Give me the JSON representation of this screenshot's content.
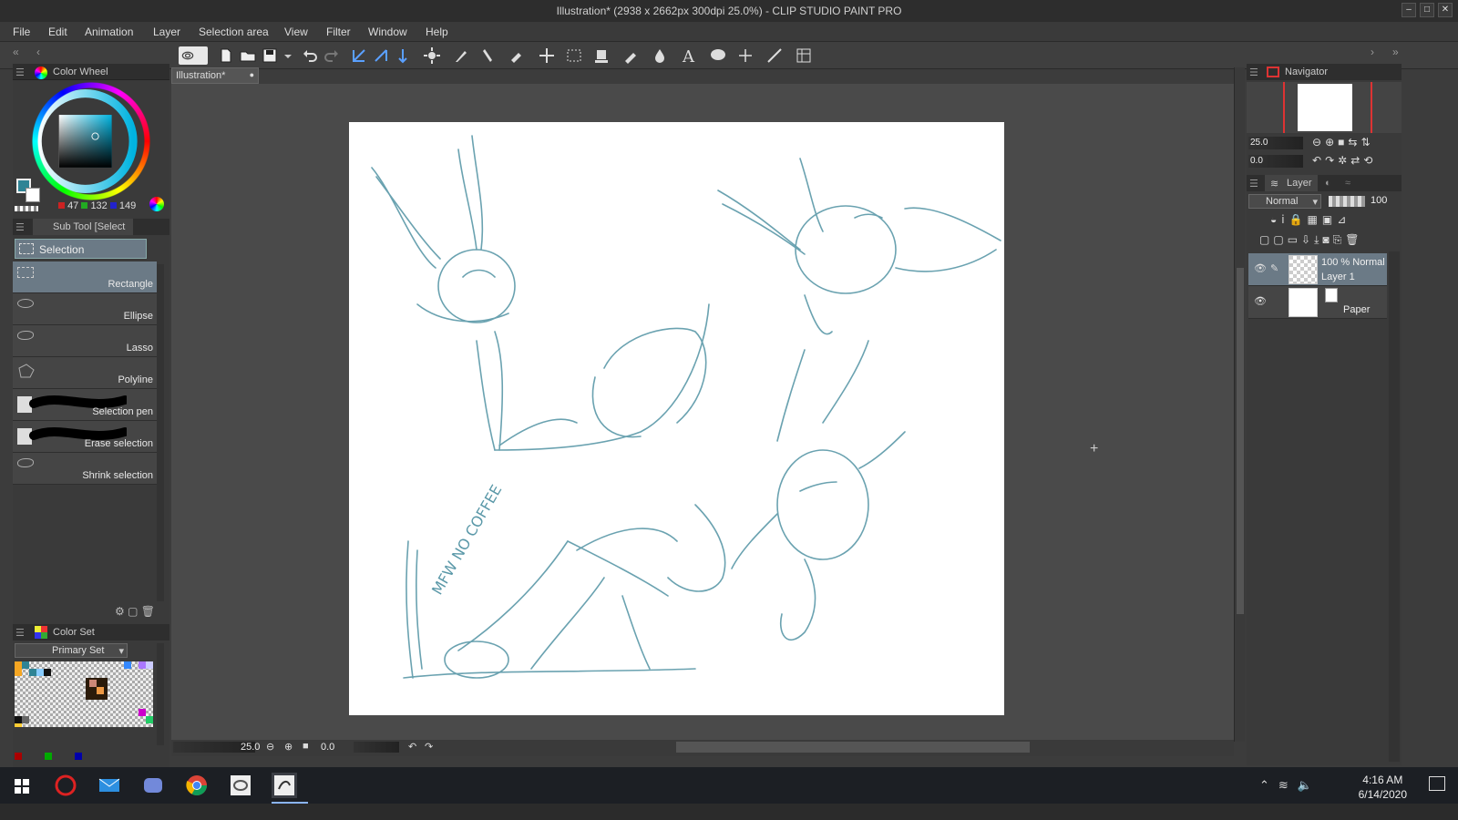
{
  "window": {
    "title": "Illustration* (2938 x 2662px 300dpi 25.0%)  - CLIP STUDIO PAINT PRO"
  },
  "menu": [
    "File",
    "Edit",
    "Animation",
    "Layer",
    "Selection area",
    "View",
    "Filter",
    "Window",
    "Help"
  ],
  "document": {
    "tab": "Illustration*"
  },
  "color_wheel": {
    "panel_title": "Color Wheel",
    "r": "47",
    "g": "132",
    "b": "149",
    "main_color": "#2f8495",
    "sub_color": "#ffffff"
  },
  "sub_tool": {
    "panel_title": "Sub Tool [Select",
    "group": "Selection",
    "items": [
      "Rectangle",
      "Ellipse",
      "Lasso",
      "Polyline",
      "Selection pen",
      "Erase selection",
      "Shrink selection"
    ]
  },
  "color_set": {
    "panel_title": "Color Set",
    "set_name": "Primary Set"
  },
  "navigator": {
    "panel_title": "Navigator",
    "zoom": "25.0",
    "rotation": "0.0"
  },
  "layer_panel": {
    "panel_title": "Layer",
    "blend": "Normal",
    "opacity": "100",
    "layers": [
      {
        "line1": "100 % Normal",
        "line2": "Layer 1"
      },
      {
        "line1": "",
        "line2": "Paper"
      }
    ]
  },
  "statusbar": {
    "zoom": "25.0",
    "rotation": "0.0"
  },
  "sketch": {
    "text": "MFW NO COFFEE",
    "stroke_color": "#5a98a8"
  },
  "taskbar": {
    "time": "4:16 AM",
    "date": "6/14/2020"
  },
  "colors": {
    "accent": "#2f8495",
    "panel": "#3a3a3a",
    "canvas_bg": "#4a4a4a"
  }
}
